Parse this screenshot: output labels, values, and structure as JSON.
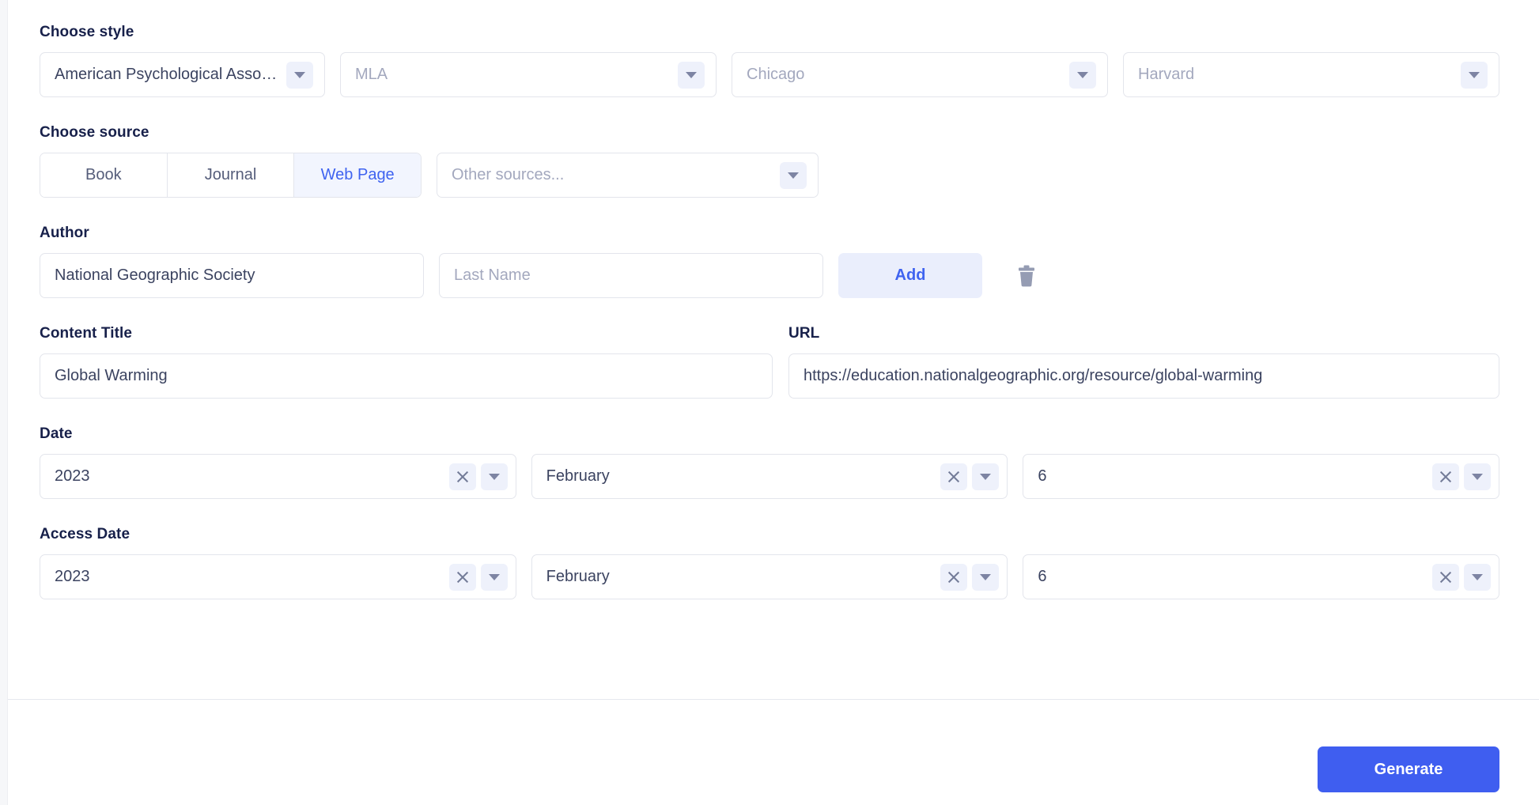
{
  "style_section": {
    "label": "Choose style",
    "dropdowns": [
      {
        "name": "apa",
        "value": "American Psychological Associatio…",
        "filled": true
      },
      {
        "name": "mla",
        "value": "MLA",
        "filled": false
      },
      {
        "name": "chicago",
        "value": "Chicago",
        "filled": false
      },
      {
        "name": "harvard",
        "value": "Harvard",
        "filled": false
      }
    ]
  },
  "source_section": {
    "label": "Choose source",
    "tabs": [
      {
        "label": "Book",
        "active": false
      },
      {
        "label": "Journal",
        "active": false
      },
      {
        "label": "Web Page",
        "active": true
      }
    ],
    "other_sources_placeholder": "Other sources..."
  },
  "author_section": {
    "label": "Author",
    "first_name_value": "National Geographic Society",
    "last_name_placeholder": "Last Name",
    "add_label": "Add",
    "delete_icon": "trash-icon"
  },
  "content_section": {
    "title_label": "Content Title",
    "title_value": "Global Warming",
    "url_label": "URL",
    "url_value": "https://education.nationalgeographic.org/resource/global-warming"
  },
  "date_section": {
    "label": "Date",
    "year": "2023",
    "month": "February",
    "day": "6"
  },
  "access_date_section": {
    "label": "Access Date",
    "year": "2023",
    "month": "February",
    "day": "6"
  },
  "footer": {
    "generate_label": "Generate"
  },
  "colors": {
    "accent_blue": "#3f5ef0",
    "light_accent_bg": "#eaeefc",
    "active_tab_bg": "#f2f5fe",
    "label_navy": "#17204a",
    "border": "#e3e5ec",
    "placeholder": "#a3a8be"
  }
}
